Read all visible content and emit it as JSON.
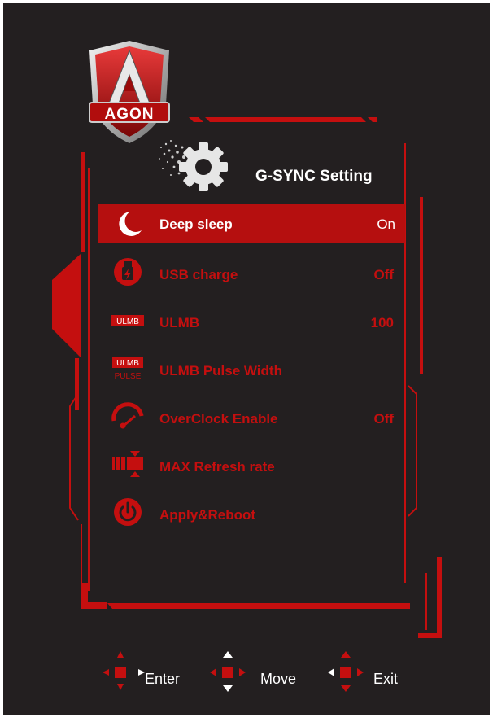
{
  "brand": {
    "logo_text": "AGON"
  },
  "header": {
    "title": "G-SYNC Setting"
  },
  "menu": {
    "items": [
      {
        "label": "Deep sleep",
        "value": "On",
        "icon": "moon-icon",
        "selected": true
      },
      {
        "label": "USB charge",
        "value": "Off",
        "icon": "usb-charge-icon",
        "selected": false
      },
      {
        "label": "ULMB",
        "value": "100",
        "icon": "ulmb-icon",
        "selected": false,
        "badge": "ULMB"
      },
      {
        "label": "ULMB Pulse Width",
        "value": "",
        "icon": "ulmb-pulse-icon",
        "selected": false,
        "badge": "ULMB",
        "badge_sub": "PULSE"
      },
      {
        "label": "OverClock Enable",
        "value": "Off",
        "icon": "speedometer-icon",
        "selected": false
      },
      {
        "label": "MAX Refresh rate",
        "value": "",
        "icon": "refresh-rate-icon",
        "selected": false
      },
      {
        "label": "Apply&Reboot",
        "value": "",
        "icon": "power-icon",
        "selected": false
      }
    ]
  },
  "footer": {
    "legend": [
      {
        "label": "Enter",
        "icon": "dpad-enter-icon"
      },
      {
        "label": "Move",
        "icon": "dpad-move-icon"
      },
      {
        "label": "Exit",
        "icon": "dpad-exit-icon"
      }
    ]
  },
  "colors": {
    "background": "#231f20",
    "accent_red": "#c40f0f",
    "selected_row": "#b50f0f",
    "text": "#ffffff"
  }
}
